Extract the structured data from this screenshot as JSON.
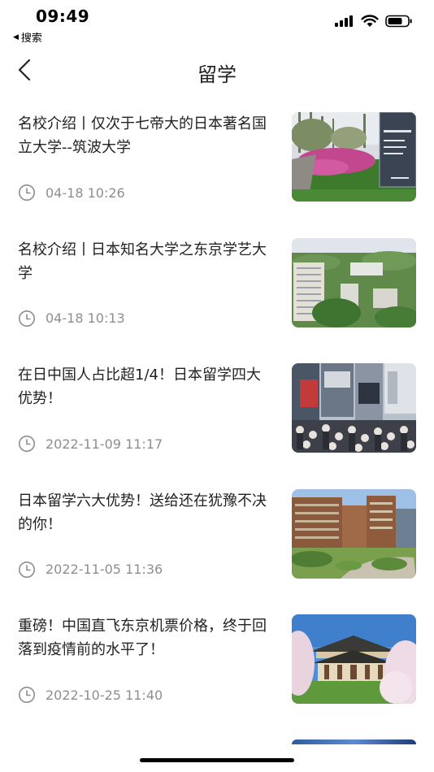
{
  "status_bar": {
    "time": "09:49",
    "back_app": "搜索",
    "icons": [
      "signal-icon",
      "wifi-icon",
      "battery-icon"
    ]
  },
  "nav": {
    "title": "留学",
    "back_icon": "chevron-left-icon"
  },
  "articles": [
    {
      "title": "名校介绍丨仅次于七帝大的日本著名国立大学--筑波大学",
      "time": "04-18 10:26",
      "thumb": "tsukuba-campus"
    },
    {
      "title": "名校介绍丨日本知名大学之东京学艺大学",
      "time": "04-18 10:13",
      "thumb": "gakugei-campus"
    },
    {
      "title": "在日中国人占比超1/4！日本留学四大优势！",
      "time": "2022-11-09 11:17",
      "thumb": "shibuya-crossing"
    },
    {
      "title": "日本留学六大优势！送给还在犹豫不决的你！",
      "time": "2022-11-05 11:36",
      "thumb": "university-campus"
    },
    {
      "title": "重磅！中国直飞东京机票价格，终于回落到疫情前的水平了！",
      "time": "2022-10-25 11:40",
      "thumb": "todaiji-temple"
    }
  ],
  "colors": {
    "title_text": "#222222",
    "meta_text": "#8e8e8e",
    "background": "#ffffff"
  }
}
